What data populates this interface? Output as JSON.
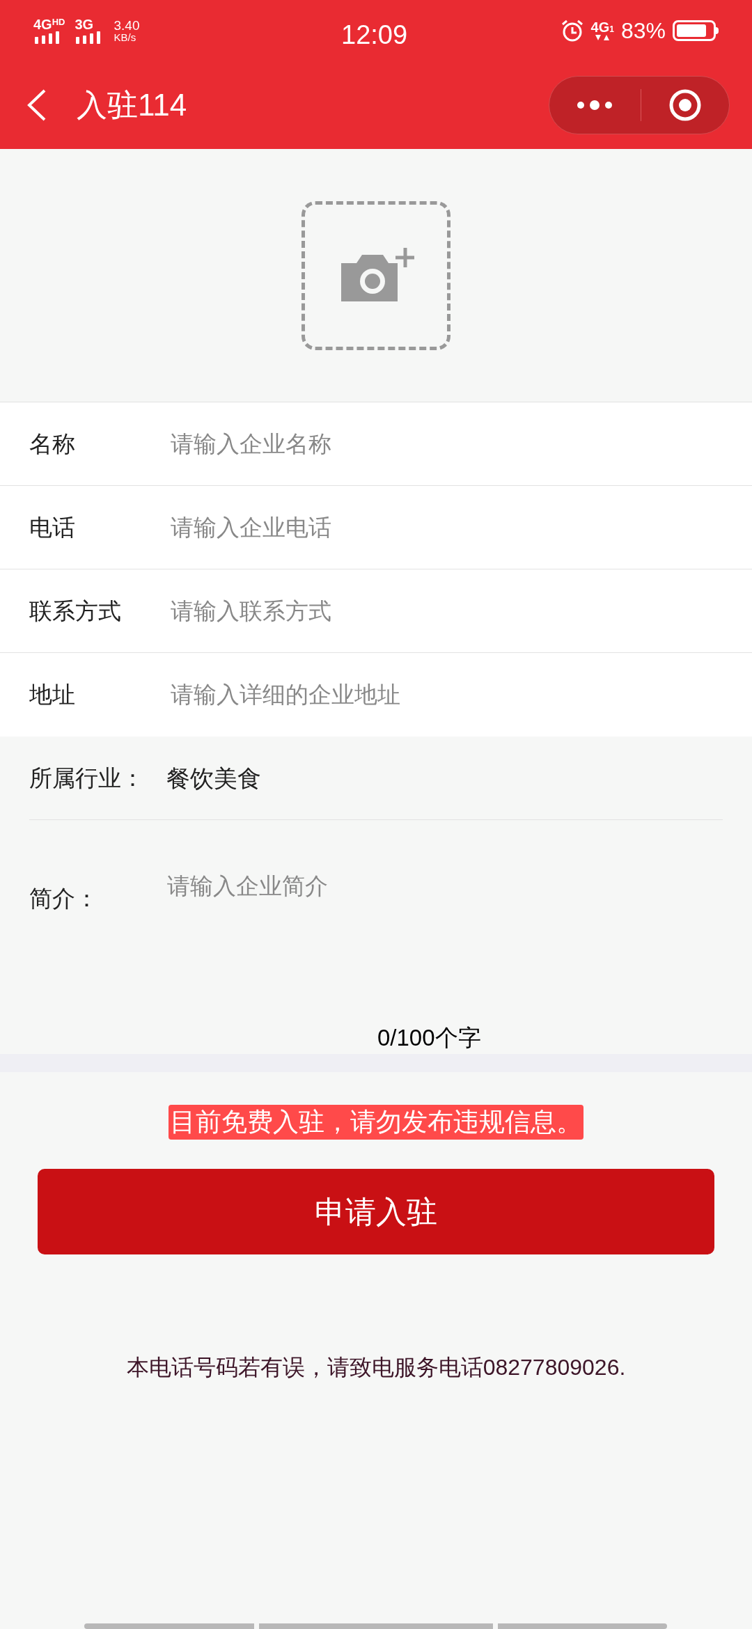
{
  "status_bar": {
    "network_1": "4G",
    "network_1_sup": "HD",
    "network_2": "3G",
    "speed_value": "3.40",
    "speed_unit": "KB/s",
    "time": "12:09",
    "network_3": "4G",
    "network_3_sub": "1",
    "battery": "83%"
  },
  "header": {
    "title": "入驻114"
  },
  "fields": [
    {
      "label": "名称",
      "placeholder": "请输入企业名称"
    },
    {
      "label": "电话",
      "placeholder": "请输入企业电话"
    },
    {
      "label": "联系方式",
      "placeholder": "请输入联系方式"
    },
    {
      "label": "地址",
      "placeholder": "请输入详细的企业地址"
    }
  ],
  "industry": {
    "label": "所属行业：",
    "value": "餐饮美食"
  },
  "intro": {
    "label": "简介：",
    "placeholder": "请输入企业简介",
    "counter": "0/100个字"
  },
  "notice": "目前免费入驻，请勿发布违规信息。",
  "submit_button": "申请入驻",
  "footer_note": "本电话号码若有误，请致电服务电话08277809026."
}
